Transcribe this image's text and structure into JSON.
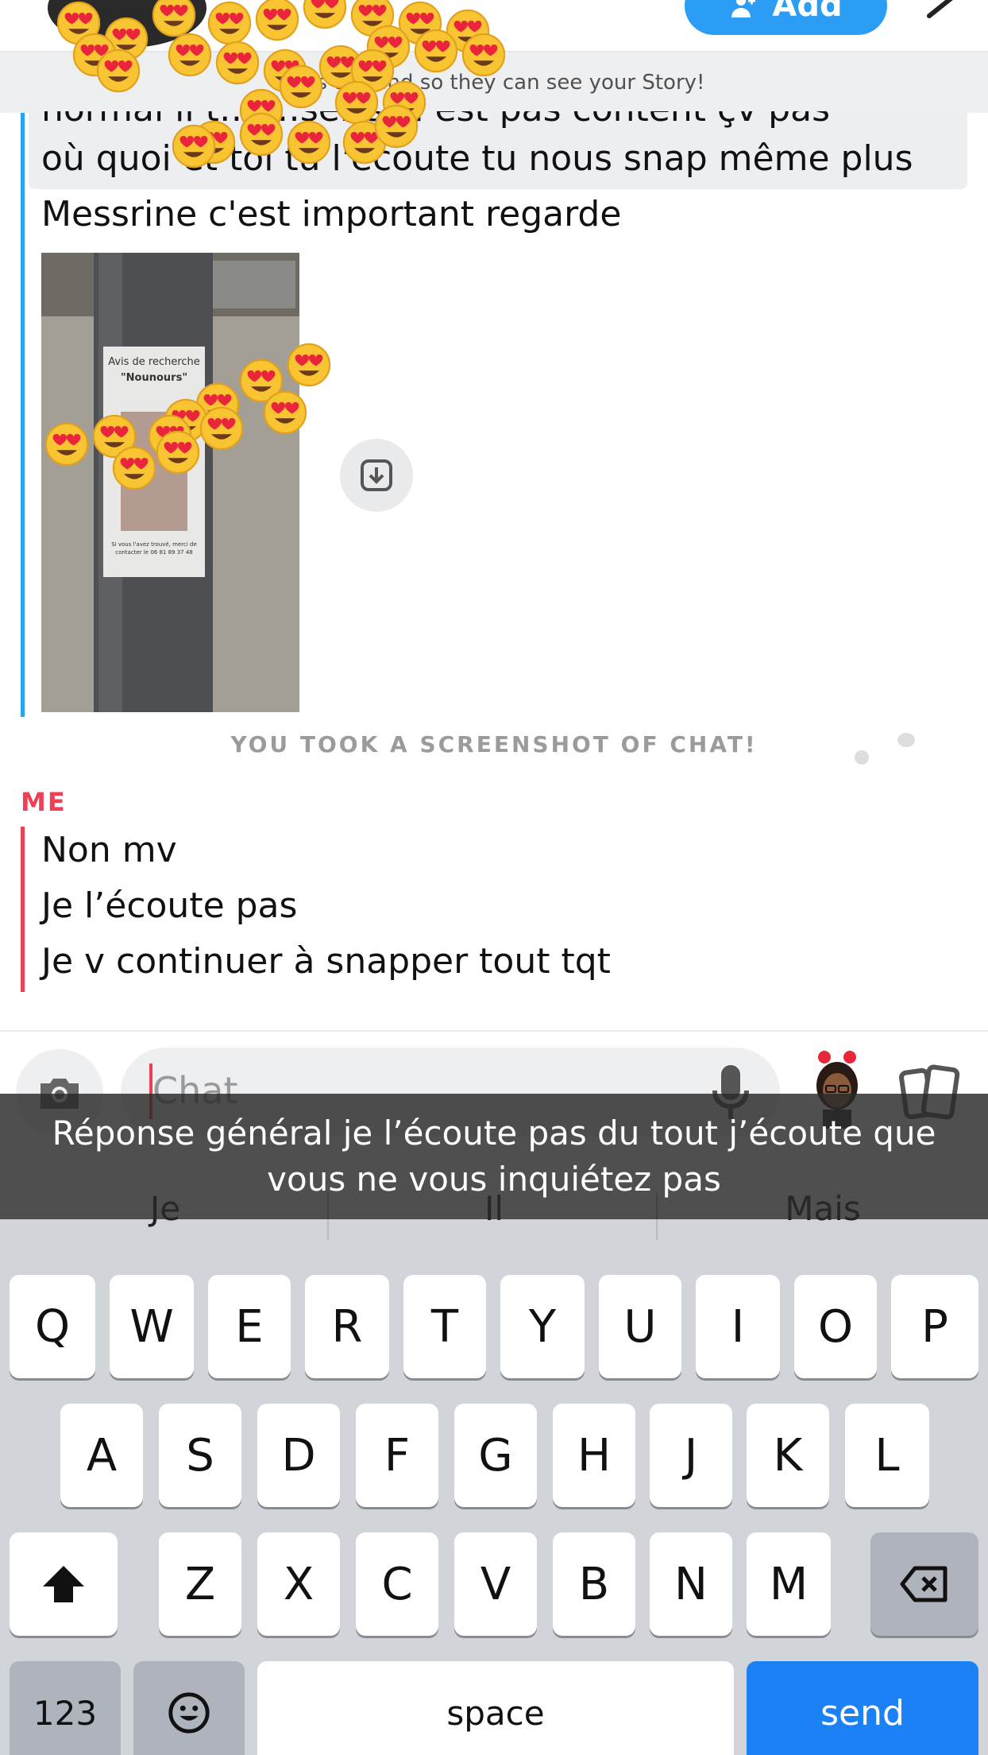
{
  "header": {
    "add_label": "Add",
    "banner_text": "…as a friend so they can see your Story!"
  },
  "messages": {
    "partial_line": "normal il t… …ser si il est pas content çv pas",
    "friend": [
      "où quoi et toi tu l'écoute tu nous snap même plus",
      "Messrine c'est important regarde"
    ],
    "photo": {
      "title": "Avis de recherche",
      "subtitle": "\"Nounours\"",
      "contact": "Si vous l'avez trouvé, merci de contacter le 06 81 89 37 48"
    }
  },
  "notice": "YOU TOOK A SCREENSHOT OF CHAT!",
  "me": {
    "label": "ME",
    "lines": [
      "Non mv",
      "Je l’écoute pas",
      "Je v continuer à snapper tout tqt"
    ]
  },
  "composer": {
    "placeholder": "Chat"
  },
  "caption": "Réponse général je l’écoute pas du tout j’écoute que vous ne vous inquiétez pas",
  "suggestions": [
    "Je",
    "Il",
    "Mais"
  ],
  "keyboard": {
    "row1": [
      "Q",
      "W",
      "E",
      "R",
      "T",
      "Y",
      "U",
      "I",
      "O",
      "P"
    ],
    "row2": [
      "A",
      "S",
      "D",
      "F",
      "G",
      "H",
      "J",
      "K",
      "L"
    ],
    "row3": [
      "Z",
      "X",
      "C",
      "V",
      "B",
      "N",
      "M"
    ],
    "num_label": "123",
    "space_label": "space",
    "send_label": "send"
  },
  "colors": {
    "friend_bar": "#27a6f0",
    "me_bar": "#ef3f54",
    "add_button": "#2b9df4",
    "send_key": "#1a82f5"
  },
  "icons": [
    "person-add-icon",
    "more-icon",
    "save-download-icon",
    "camera-icon",
    "microphone-icon",
    "bitmoji-avatar",
    "cards-icon",
    "shift-icon",
    "backspace-icon",
    "emoji-icon"
  ]
}
